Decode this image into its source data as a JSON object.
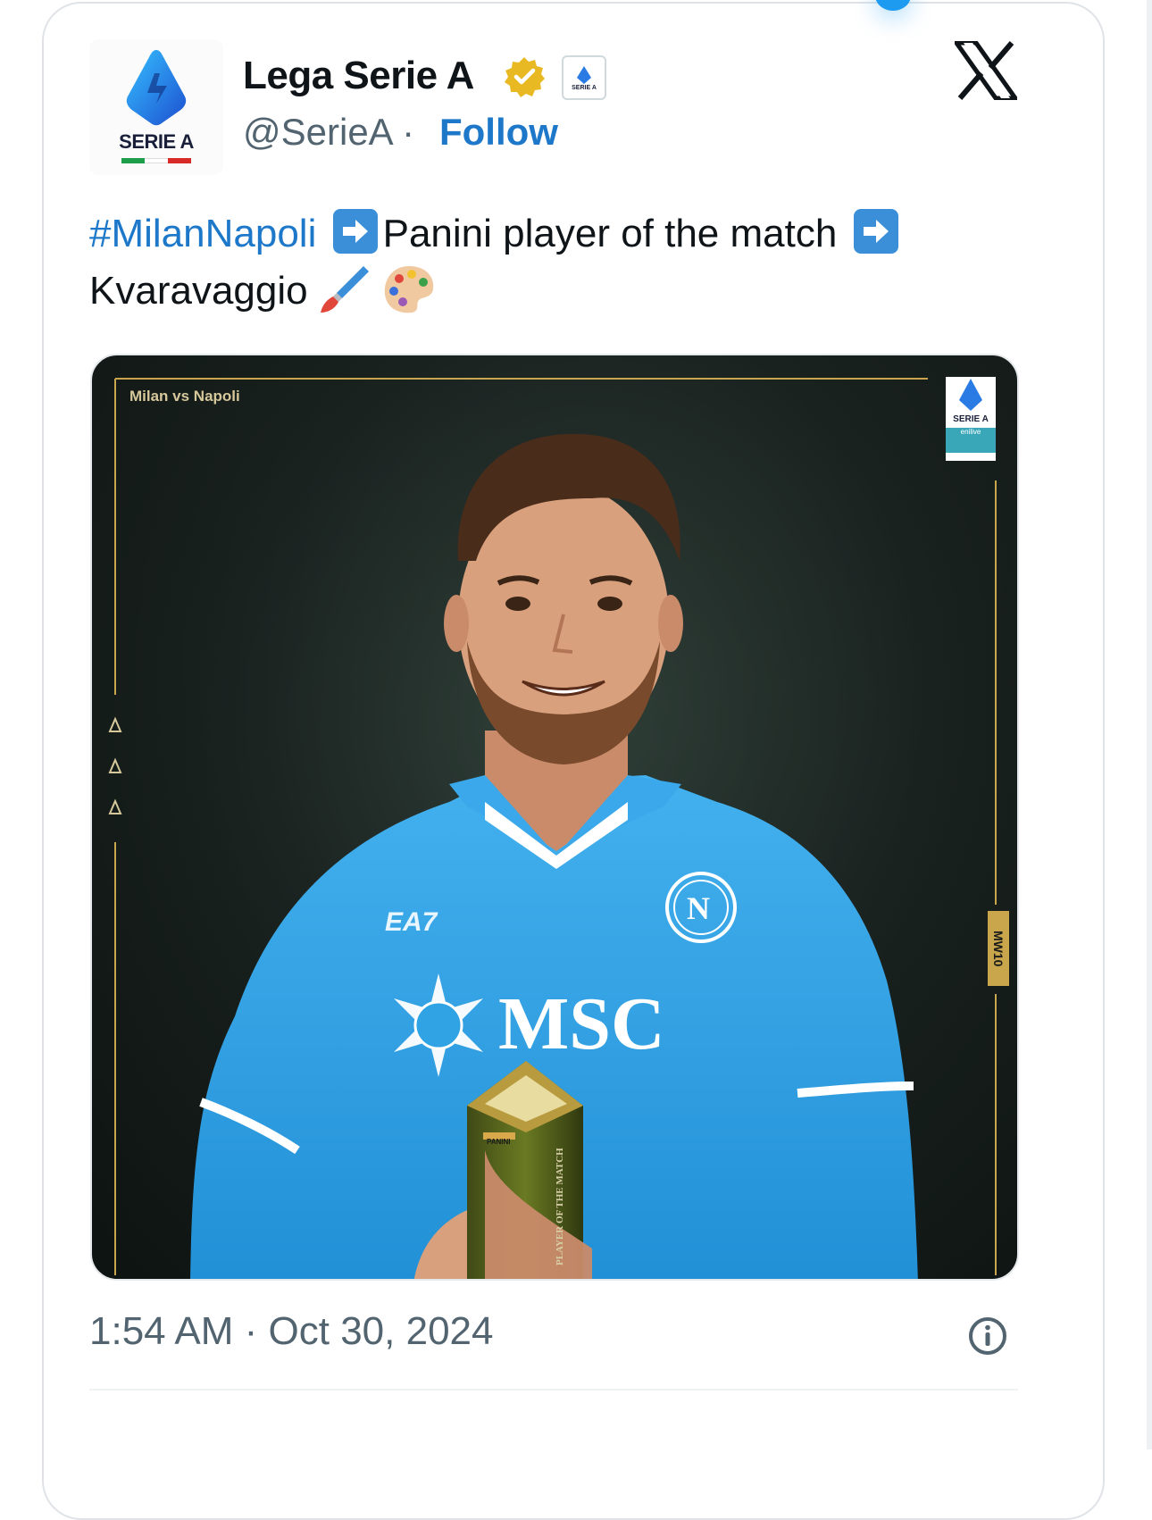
{
  "tweet": {
    "author_name": "Lega Serie A",
    "handle": "@SerieA",
    "separator": "·",
    "follow_label": "Follow",
    "avatar_text": "SERIE A",
    "affiliate_badge_text": "SERIE A",
    "hashtag": "#MilanNapoli",
    "text_middle": "Panini player of the match",
    "text_end": "Kvaravaggio",
    "timestamp": "1:54 AM · Oct 30, 2024"
  },
  "media": {
    "match_label": "Milan vs Napoli",
    "matchweek": "MW10",
    "corner_logo_text": "SERIE A",
    "corner_logo_sub": "enilive",
    "jersey_sponsor": "MSC",
    "jersey_kit": "EA7",
    "jersey_crest": "N",
    "trophy_text": "PLAYER OF THE MATCH",
    "trophy_brand": "PANINI"
  },
  "icons": {
    "verified": "verified-badge-icon",
    "x_logo": "x-logo-icon",
    "info": "info-icon",
    "arrow": "right-arrow-emoji",
    "brush": "paintbrush-emoji",
    "palette": "palette-emoji"
  },
  "colors": {
    "link_blue": "#1d78c9",
    "muted": "#536471",
    "gold": "#c9a64b",
    "jersey_blue": "#2fa3e3"
  }
}
